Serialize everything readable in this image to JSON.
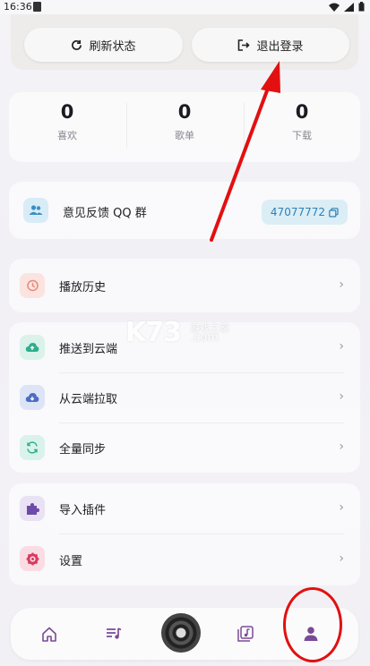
{
  "status_bar": {
    "time": "16:36"
  },
  "top_actions": {
    "refresh_label": "刷新状态",
    "logout_label": "退出登录"
  },
  "stats": [
    {
      "value": "0",
      "label": "喜欢"
    },
    {
      "value": "0",
      "label": "歌单"
    },
    {
      "value": "0",
      "label": "下载"
    }
  ],
  "feedback": {
    "label": "意见反馈 QQ 群",
    "qq_number": "47077772"
  },
  "menu_history": {
    "label": "播放历史"
  },
  "menu_cloud": [
    {
      "label": "推送到云端"
    },
    {
      "label": "从云端拉取"
    },
    {
      "label": "全量同步"
    }
  ],
  "menu_settings": [
    {
      "label": "导入插件"
    },
    {
      "label": "设置"
    }
  ],
  "watermark": {
    "brand": "K73",
    "cn": "游戏之家",
    "domain": ".com"
  },
  "colors": {
    "accent": "#7a4a96",
    "annotation_red": "#e21010",
    "qq_blue": "#2f7fb4"
  }
}
